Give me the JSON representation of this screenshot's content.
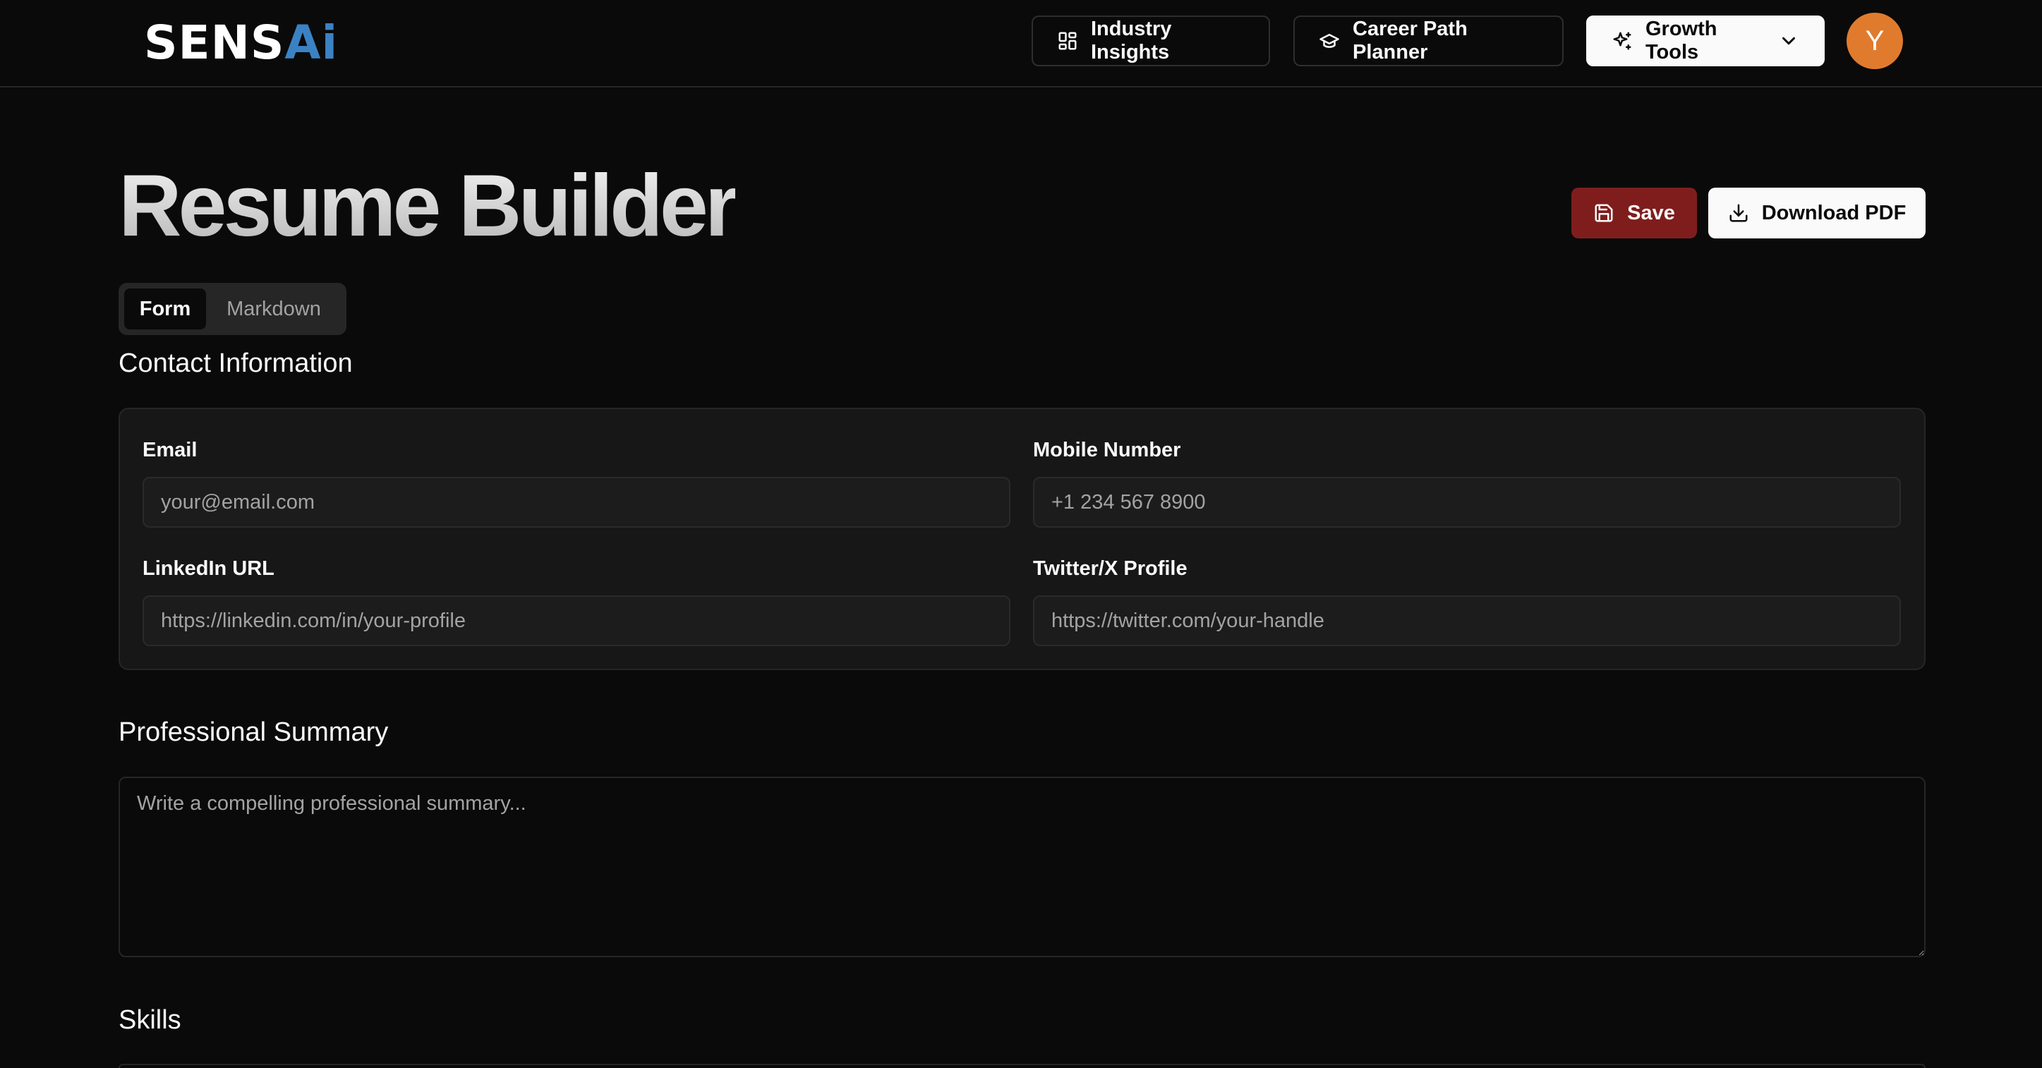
{
  "brand": {
    "logo_main": "SENS",
    "logo_accent": "Ai"
  },
  "nav": {
    "industry_insights": "Industry Insights",
    "career_path_planner": "Career Path Planner",
    "growth_tools": "Growth Tools",
    "avatar_initial": "Y"
  },
  "page": {
    "title": "Resume Builder",
    "save_label": "Save",
    "download_label": "Download PDF"
  },
  "tabs": {
    "form": "Form",
    "markdown": "Markdown",
    "active": "Form"
  },
  "contact": {
    "heading": "Contact Information",
    "email_label": "Email",
    "email_placeholder": "your@email.com",
    "mobile_label": "Mobile Number",
    "mobile_placeholder": "+1 234 567 8900",
    "linkedin_label": "LinkedIn URL",
    "linkedin_placeholder": "https://linkedin.com/in/your-profile",
    "twitter_label": "Twitter/X Profile",
    "twitter_placeholder": "https://twitter.com/your-handle"
  },
  "summary": {
    "heading": "Professional Summary",
    "placeholder": "Write a compelling professional summary..."
  },
  "skills": {
    "heading": "Skills"
  },
  "colors": {
    "background": "#0a0a0a",
    "save_button": "#7f1d1d",
    "avatar": "#e07b2e",
    "logo_accent": "#3b82c4"
  },
  "icons": {
    "industry_insights": "grid-icon",
    "career_path_planner": "graduation-cap-icon",
    "growth_tools": "sparkles-icon",
    "growth_dropdown": "chevron-down-icon",
    "save": "save-icon",
    "download": "download-icon"
  }
}
